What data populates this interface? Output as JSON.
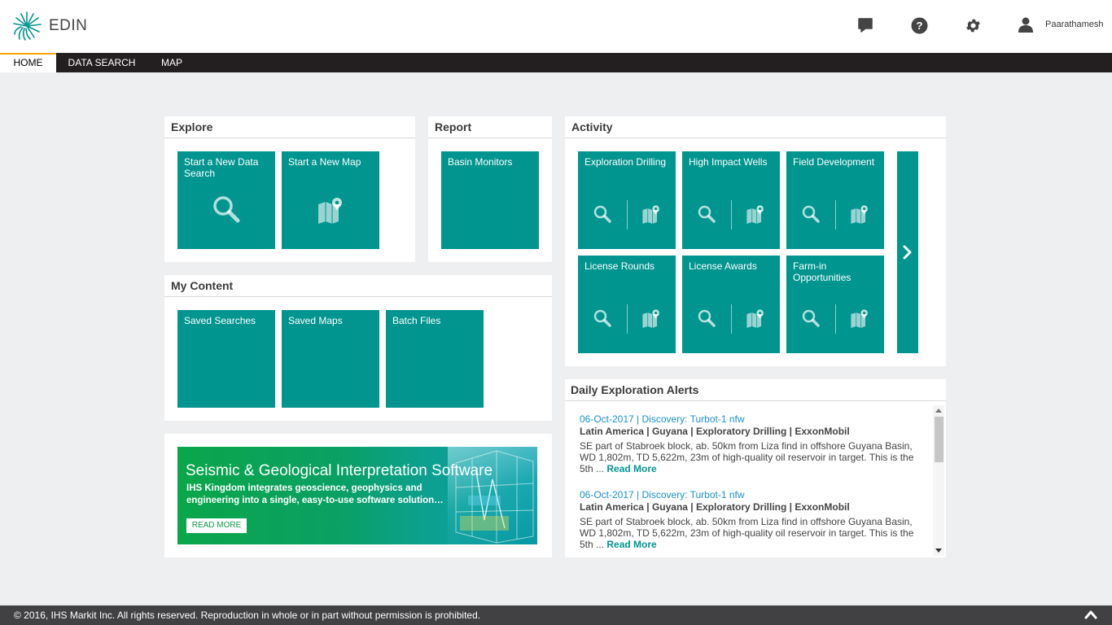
{
  "app": {
    "logo_text": "EDIN",
    "user_name": "Paarathamesh"
  },
  "header_icons": [
    "chat-icon",
    "help-icon",
    "settings-icon",
    "user-icon"
  ],
  "nav": {
    "tabs": [
      "HOME",
      "DATA SEARCH",
      "MAP"
    ],
    "active": "HOME"
  },
  "explore": {
    "title": "Explore",
    "tiles": [
      {
        "label": "Start a New Data Search",
        "icon": "search-icon"
      },
      {
        "label": "Start a New Map",
        "icon": "map-icon"
      }
    ]
  },
  "report": {
    "title": "Report",
    "tiles": [
      {
        "label": "Basin Monitors"
      }
    ]
  },
  "my_content": {
    "title": "My Content",
    "tiles": [
      {
        "label": "Saved Searches"
      },
      {
        "label": "Saved Maps"
      },
      {
        "label": "Batch Files"
      }
    ]
  },
  "activity": {
    "title": "Activity",
    "tiles": [
      {
        "label": "Exploration Drilling"
      },
      {
        "label": "High Impact Wells"
      },
      {
        "label": "Field Development"
      },
      {
        "label": "License Rounds"
      },
      {
        "label": "License Awards"
      },
      {
        "label": "Farm-in Opportunities"
      }
    ]
  },
  "alerts": {
    "title": "Daily Exploration Alerts",
    "items": [
      {
        "link": "06-Oct-2017 | Discovery: Turbot-1 nfw",
        "meta": "Latin America | Guyana | Exploratory Drilling | ExxonMobil",
        "text": "SE part of Stabroek block, ab. 50km from Liza find in offshore Guyana Basin, WD 1,802m, TD 5,622m, 23m of high-quality oil reservoir in target.  This is the 5th ...",
        "read_more": "Read More"
      },
      {
        "link": "06-Oct-2017 | Discovery: Turbot-1 nfw",
        "meta": "Latin America | Guyana | Exploratory Drilling | ExxonMobil",
        "text": "SE part of Stabroek block, ab. 50km from Liza find in offshore Guyana Basin, WD 1,802m, TD 5,622m, 23m of high-quality oil reservoir in target.  This is the 5th ...",
        "read_more": "Read More"
      }
    ]
  },
  "banner": {
    "title": "Seismic & Geological Interpretation Software",
    "subtitle": "IHS Kingdom integrates geoscience, geophysics and engineering into a single, easy-to-use software solution…",
    "button": "READ MORE"
  },
  "footer": {
    "text": "© 2016, IHS Markit Inc. All rights reserved. Reproduction in whole or in part without permission is prohibited."
  },
  "colors": {
    "tile": "#00958f",
    "nav": "#231f20",
    "footer": "#414042",
    "accent": "#f7a600",
    "link": "#1a8fd0"
  }
}
